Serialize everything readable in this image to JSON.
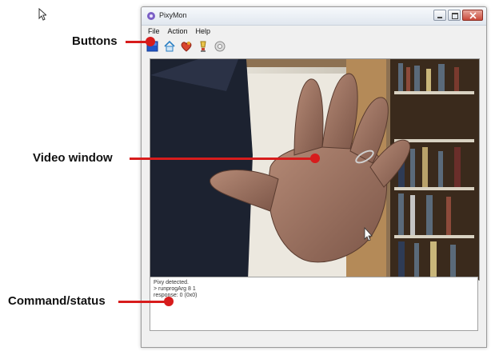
{
  "window": {
    "title": "PixyMon",
    "menu": [
      "File",
      "Action",
      "Help"
    ],
    "toolbar_buttons": [
      {
        "name": "run-button",
        "icon": "blue-square-icon"
      },
      {
        "name": "home-button",
        "icon": "house-icon"
      },
      {
        "name": "config-button",
        "icon": "heart-icon"
      },
      {
        "name": "signature-button",
        "icon": "bulb-icon"
      },
      {
        "name": "settings-button",
        "icon": "gear-icon"
      }
    ]
  },
  "status": {
    "lines": [
      "Pixy detected.",
      "> runprogArg 8 1",
      "response: 0 (0x0)"
    ]
  },
  "annotations": {
    "buttons": "Buttons",
    "video_window": "Video window",
    "command_status": "Command/status"
  },
  "colors": {
    "annotation_red": "#d71c1c",
    "window_bg": "#f0f0f0"
  }
}
